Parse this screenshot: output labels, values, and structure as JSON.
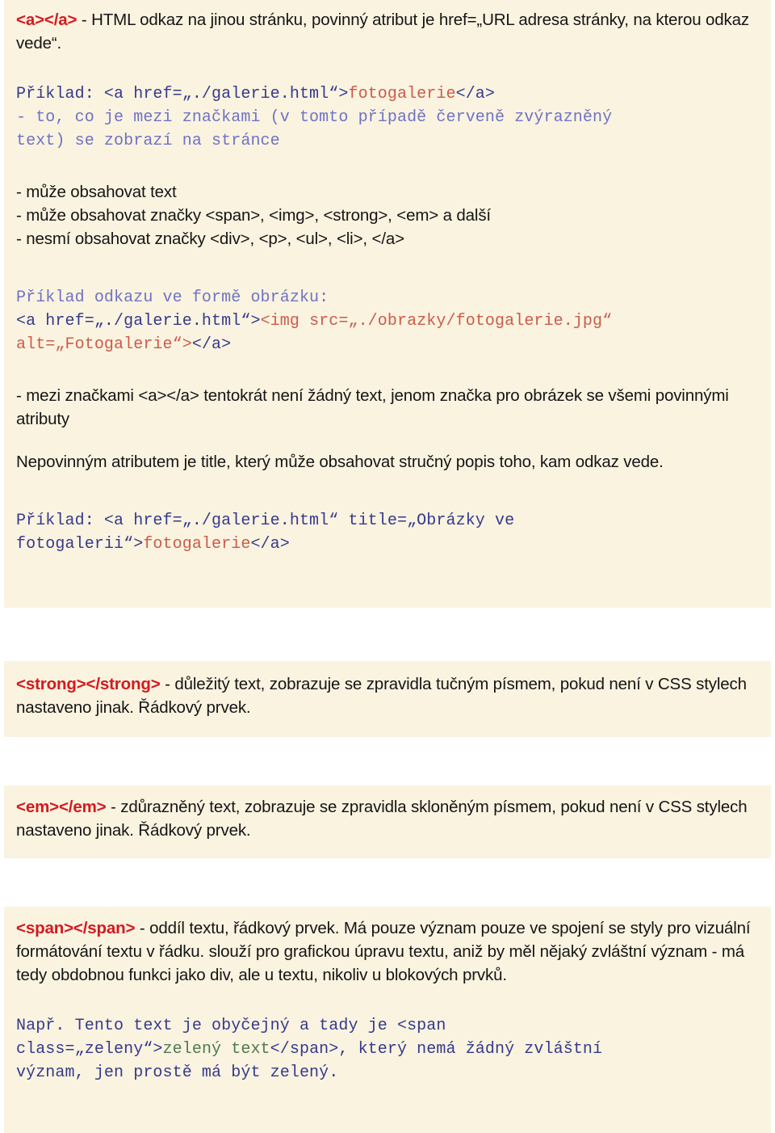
{
  "document": {
    "language": "cs",
    "page_background": "#ffffff",
    "block_background": "#faf3e0",
    "colors": {
      "tag_red": "#d6191e",
      "code_navy": "#353a8c",
      "code_light_blue": "#6f73c4",
      "code_red": "#cc5b4a",
      "code_green": "#4e7a4e",
      "body_text": "#151515"
    }
  },
  "sections": {
    "anchor": {
      "tag_label": "<a></a>",
      "intro_text": " - HTML odkaz na jinou stránku, povinný atribut je href=„URL adresa stránky, na kterou odkaz vede“.",
      "example_1": {
        "line1_prefix": "Příklad: <a href=„./galerie.html“>",
        "line1_highlight": "fotogalerie",
        "line1_suffix": "</a>",
        "line2": "- to, co je mezi značkami (v tomto případě červeně zvýrazněný",
        "line3": "text) se zobrazí na stránce"
      },
      "bullets": [
        "- může obsahovat text",
        "- může obsahovat značky <span>, <img>, <strong>, <em> a další",
        "- nesmí obsahovat značky <div>, <p>, <ul>, <li>, </a>"
      ],
      "example_2": {
        "line1": "Příklad odkazu ve formě obrázku:",
        "line2_navy": "<a href=„./galerie.html“>",
        "line2_red": "<img src=„./obrazky/fotogalerie.jpg“",
        "line3_red": "alt=„Fotogalerie“>",
        "line3_navy": "</a>"
      },
      "note_1": "- mezi značkami <a></a> tentokrát není žádný text, jenom značka pro obrázek se všemi povinnými atributy",
      "note_2": "Nepovinným atributem je title, který může obsahovat stručný popis toho, kam odkaz vede.",
      "example_3": {
        "line1": "Příklad: <a href=„./galerie.html“ title=„Obrázky ve",
        "line2_prefix": "fotogalerii“>",
        "line2_highlight": "fotogalerie",
        "line2_suffix": "</a>"
      }
    },
    "strong": {
      "tag_label": "<strong></strong>",
      "text": " - důležitý text, zobrazuje se zpravidla tučným písmem, pokud není v CSS stylech nastaveno jinak. Řádkový prvek."
    },
    "em": {
      "tag_label": "<em></em>",
      "text": " - zdůrazněný text, zobrazuje se zpravidla skloněným písmem, pokud není v CSS stylech nastaveno jinak. Řádkový prvek."
    },
    "span": {
      "tag_label": "<span></span>",
      "text": " - oddíl textu, řádkový prvek. Má pouze význam pouze ve spojení se styly pro vizuální formátování textu v řádku. slouží pro grafickou úpravu textu, aniž by měl nějaký zvláštní význam - má tedy obdobnou funkci jako div, ale u textu, nikoliv u blokových prvků.",
      "example": {
        "line1": "Např. Tento text je obyčejný a tady je <span",
        "line2_prefix": "class=„zeleny“>",
        "line2_green": "zelený text",
        "line2_suffix": "</span>, který nemá žádný zvláštní",
        "line3": "význam, jen prostě má být zelený."
      }
    }
  }
}
